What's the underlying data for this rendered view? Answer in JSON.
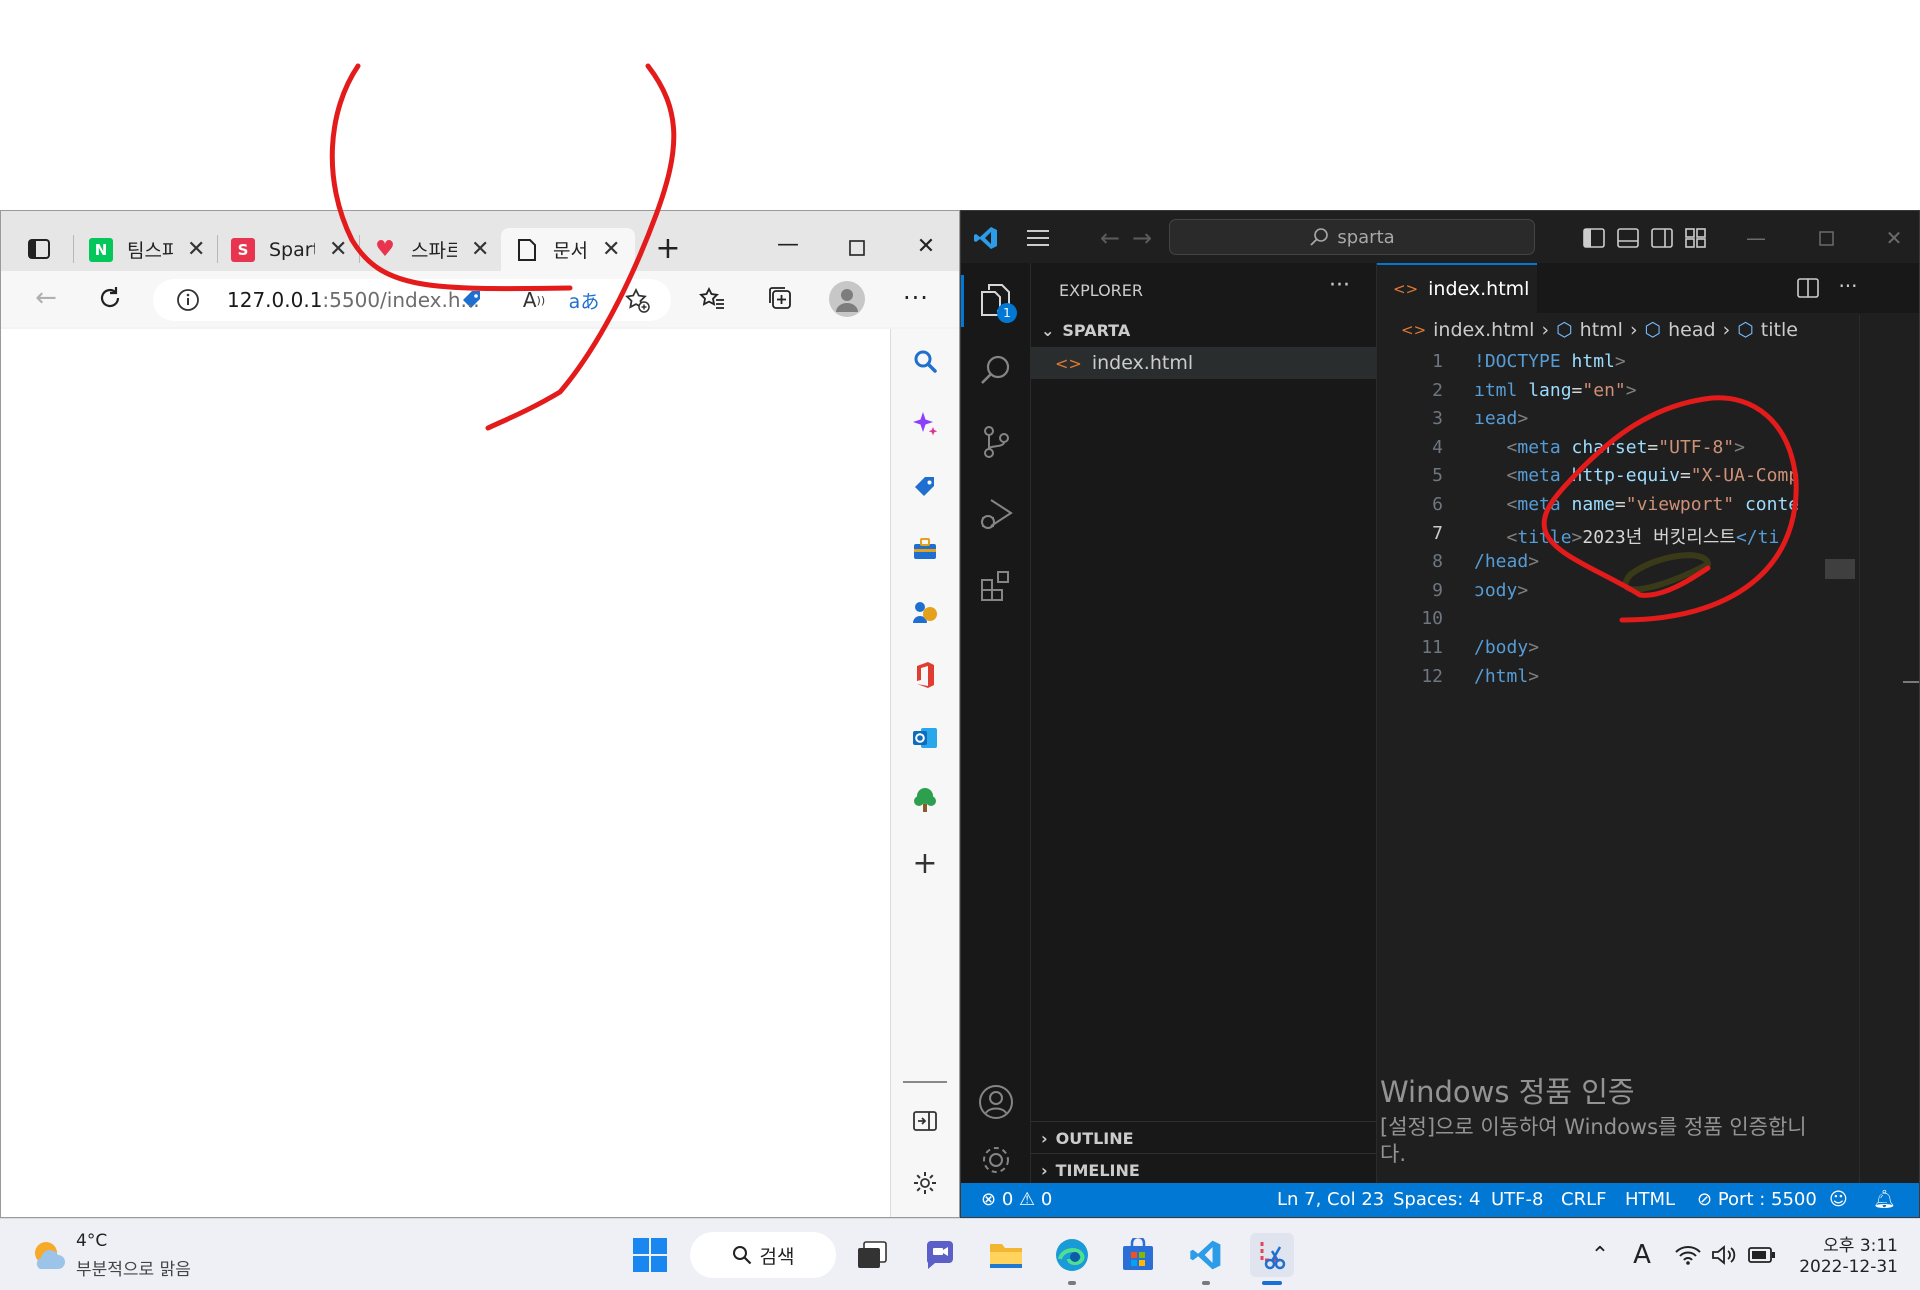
{
  "browser": {
    "tabs": [
      {
        "title": "팀스파",
        "favicon": "N",
        "favicon_color": "#03c75a"
      },
      {
        "title": "Sparta",
        "favicon": "S",
        "favicon_color": "#e8344e"
      },
      {
        "title": "스파르",
        "favicon": "♥",
        "favicon_color": "#e8344e"
      },
      {
        "title": "문서",
        "favicon": "doc-icon",
        "active": true
      }
    ],
    "address": {
      "host": "127.0.0.1",
      "path": ":5500/index.h..."
    }
  },
  "vscode": {
    "command_center": "sparta",
    "activity_badge": "1",
    "explorer": {
      "title": "EXPLORER",
      "folder": "SPARTA",
      "files": [
        "index.html"
      ],
      "outline": "OUTLINE",
      "timeline": "TIMELINE"
    },
    "editor": {
      "tab": "index.html",
      "breadcrumb": [
        "index.html",
        "html",
        "head",
        "title"
      ],
      "lines": [
        {
          "n": "1"
        },
        {
          "n": "2"
        },
        {
          "n": "3"
        },
        {
          "n": "4"
        },
        {
          "n": "5"
        },
        {
          "n": "6"
        },
        {
          "n": "7"
        },
        {
          "n": "8"
        },
        {
          "n": "9"
        },
        {
          "n": "10"
        },
        {
          "n": "11"
        },
        {
          "n": "12"
        }
      ],
      "code": {
        "l1_tag": "!DOCTYPE",
        "l1_attr": " html",
        "l2_tag": "ıtml",
        "l2_attr": " lang",
        "l2_val": "\"en\"",
        "l3_tag": "ıead",
        "l4_tag": "meta",
        "l4_attr": " charset",
        "l4_val": "\"UTF-8\"",
        "l5_tag": "meta",
        "l5_attr": " http-equiv",
        "l5_val": "\"X-UA-Comp",
        "l6_tag": "meta",
        "l6_attr": " name",
        "l6_val": "\"viewport\"",
        "l6_attr2": " conte",
        "l7_tag": "title",
        "l7_text": "2023년 버킷리스트",
        "l7_end": "</ti",
        "l8_tag": "/head",
        "l9_tag": "ɔody",
        "l11_tag": "/body",
        "l12_tag": "/html"
      }
    },
    "status": {
      "errors": "0",
      "warnings": "0",
      "position": "Ln 7, Col 23",
      "spaces": "Spaces: 4",
      "encoding": "UTF-8",
      "eol": "CRLF",
      "language": "HTML",
      "port": "Port : 5500"
    },
    "watermark": {
      "title": "Windows 정품 인증",
      "line1": "[설정]으로 이동하여 Windows를 정품 인증합니",
      "line2": "다."
    }
  },
  "taskbar": {
    "weather_temp": "4°C",
    "weather_desc": "부분적으로 맑음",
    "search": "검색",
    "time": "오후 3:11",
    "date": "2022-12-31",
    "ime": "A"
  }
}
